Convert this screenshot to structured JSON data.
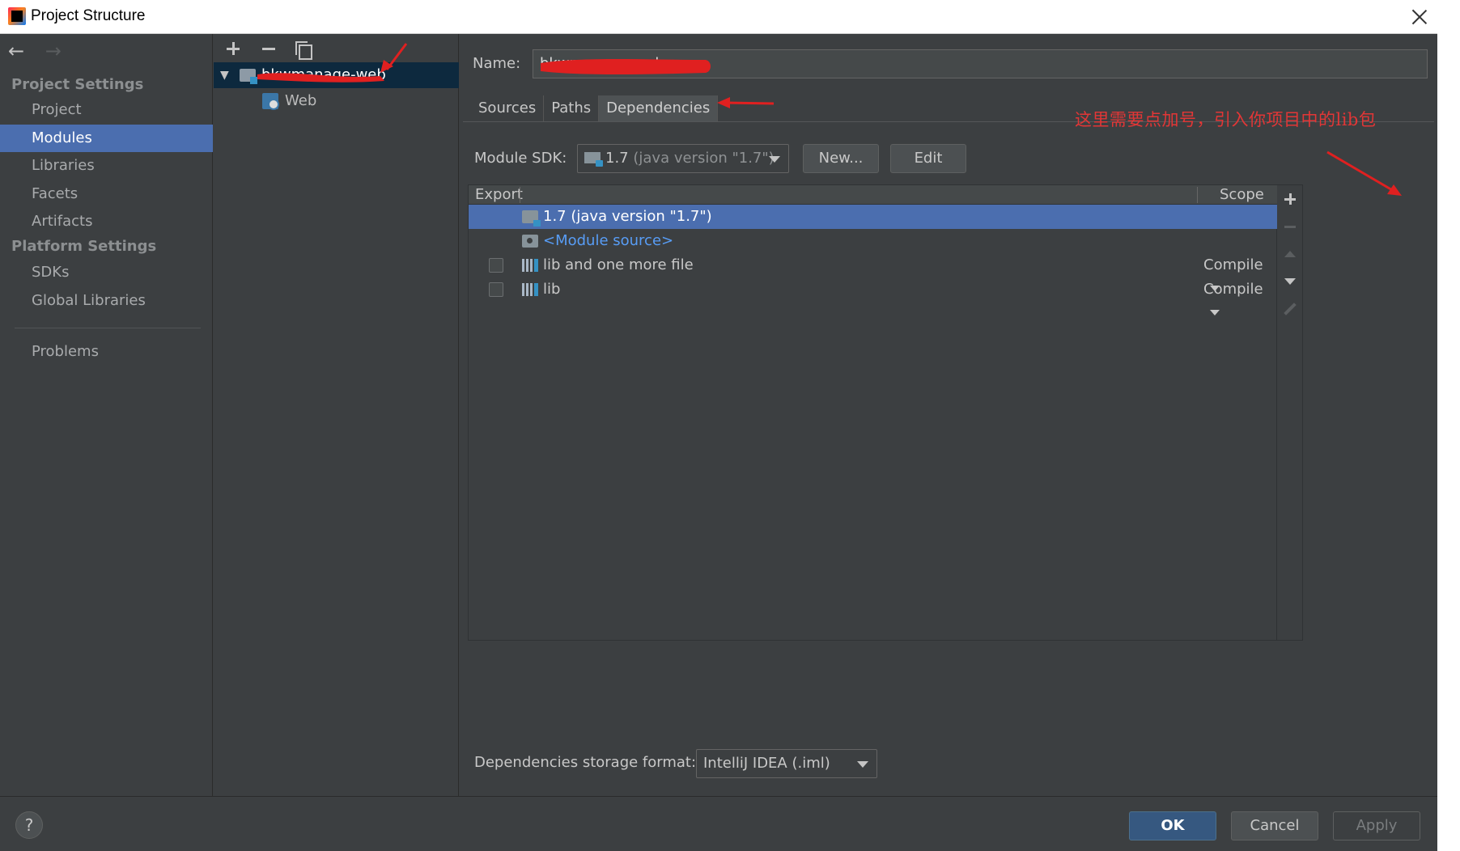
{
  "window": {
    "title": "Project Structure"
  },
  "leftnav": {
    "project_settings_header": "Project Settings",
    "project_settings_items": [
      {
        "label": "Project"
      },
      {
        "label": "Modules"
      },
      {
        "label": "Libraries"
      },
      {
        "label": "Facets"
      },
      {
        "label": "Artifacts"
      }
    ],
    "platform_settings_header": "Platform Settings",
    "platform_settings_items": [
      {
        "label": "SDKs"
      },
      {
        "label": "Global Libraries"
      }
    ],
    "problems_label": "Problems",
    "selected": "Modules"
  },
  "module_tree": {
    "root_label": "bkwmanage-web",
    "child_label": "Web"
  },
  "module": {
    "name_label": "Name:",
    "name_value": "bkwmanage-web",
    "tabs": [
      {
        "label": "Sources"
      },
      {
        "label": "Paths"
      },
      {
        "label": "Dependencies"
      }
    ],
    "active_tab": "Dependencies",
    "annotation": "这里需要点加号，引入你项目中的lib包",
    "sdk_label": "Module SDK:",
    "sdk_version": "1.7",
    "sdk_detail": "(java version \"1.7\")",
    "new_button": "New...",
    "edit_button": "Edit",
    "table_headers": {
      "export": "Export",
      "scope": "Scope"
    },
    "dependencies": [
      {
        "name_main": "1.7",
        "name_detail": "(java version \"1.7\")",
        "scope": "",
        "selected": true
      },
      {
        "name_main": "<Module source>",
        "name_detail": "",
        "scope": ""
      },
      {
        "name_main": "lib and one more file",
        "name_detail": "",
        "scope": "Compile"
      },
      {
        "name_main": "lib",
        "name_detail": "",
        "scope": "Compile"
      }
    ],
    "storage_label": "Dependencies storage format:",
    "storage_value": "IntelliJ IDEA (.iml)"
  },
  "footer": {
    "help": "?",
    "ok": "OK",
    "cancel": "Cancel",
    "apply": "Apply"
  },
  "colors": {
    "background": "#3c3f41",
    "selection": "#4b6eaf",
    "tree_selection": "#0d293e",
    "annotation_red": "#e23636",
    "link_blue": "#589df6"
  }
}
